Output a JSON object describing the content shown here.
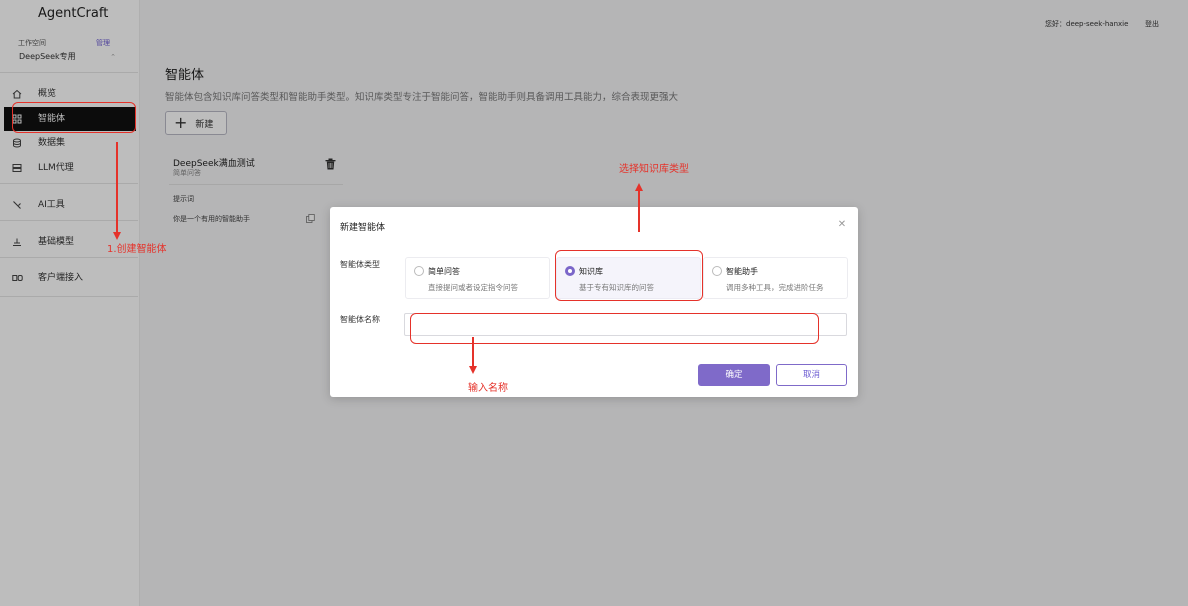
{
  "app": {
    "title": "AgentCraft"
  },
  "workspace": {
    "label": "工作空间",
    "manage": "管理",
    "selected": "DeepSeek专用"
  },
  "sidebar": {
    "items": [
      {
        "label": "概览",
        "icon": "home-icon"
      },
      {
        "label": "智能体",
        "icon": "agent-grid-icon"
      },
      {
        "label": "数据集",
        "icon": "database-icon"
      },
      {
        "label": "LLM代理",
        "icon": "server-icon"
      },
      {
        "label": "AI工具",
        "icon": "tool-icon"
      },
      {
        "label": "基础模型",
        "icon": "model-icon"
      },
      {
        "label": "客户端接入",
        "icon": "client-link-icon"
      }
    ]
  },
  "header": {
    "greeting": "您好：deep-seek-hanxie",
    "logout": "登出"
  },
  "main": {
    "title": "智能体",
    "description": "智能体包含知识库问答类型和智能助手类型。知识库类型专注于智能问答，智能助手则具备调用工具能力，综合表现更强大",
    "new_button": "新建",
    "card": {
      "title": "DeepSeek满血测试",
      "subtitle": "简单问答",
      "prompt_label": "提示词",
      "prompt": "你是一个有用的智能助手"
    }
  },
  "modal": {
    "title": "新建智能体",
    "type_label": "智能体类型",
    "name_label": "智能体名称",
    "name_value": "",
    "options": [
      {
        "title": "简单问答",
        "desc": "直接提问或者设定指令问答",
        "selected": false
      },
      {
        "title": "知识库",
        "desc": "基于专有知识库的问答",
        "selected": true
      },
      {
        "title": "智能助手",
        "desc": "调用多种工具，完成进阶任务",
        "selected": false
      }
    ],
    "ok": "确定",
    "cancel": "取消"
  },
  "annotations": {
    "step1": "1.创建智能体",
    "step2": "选择知识库类型",
    "step3": "输入名称"
  },
  "colors": {
    "accent": "#7f6ac9",
    "annotation": "#e5322a",
    "active_nav": "#111111"
  }
}
